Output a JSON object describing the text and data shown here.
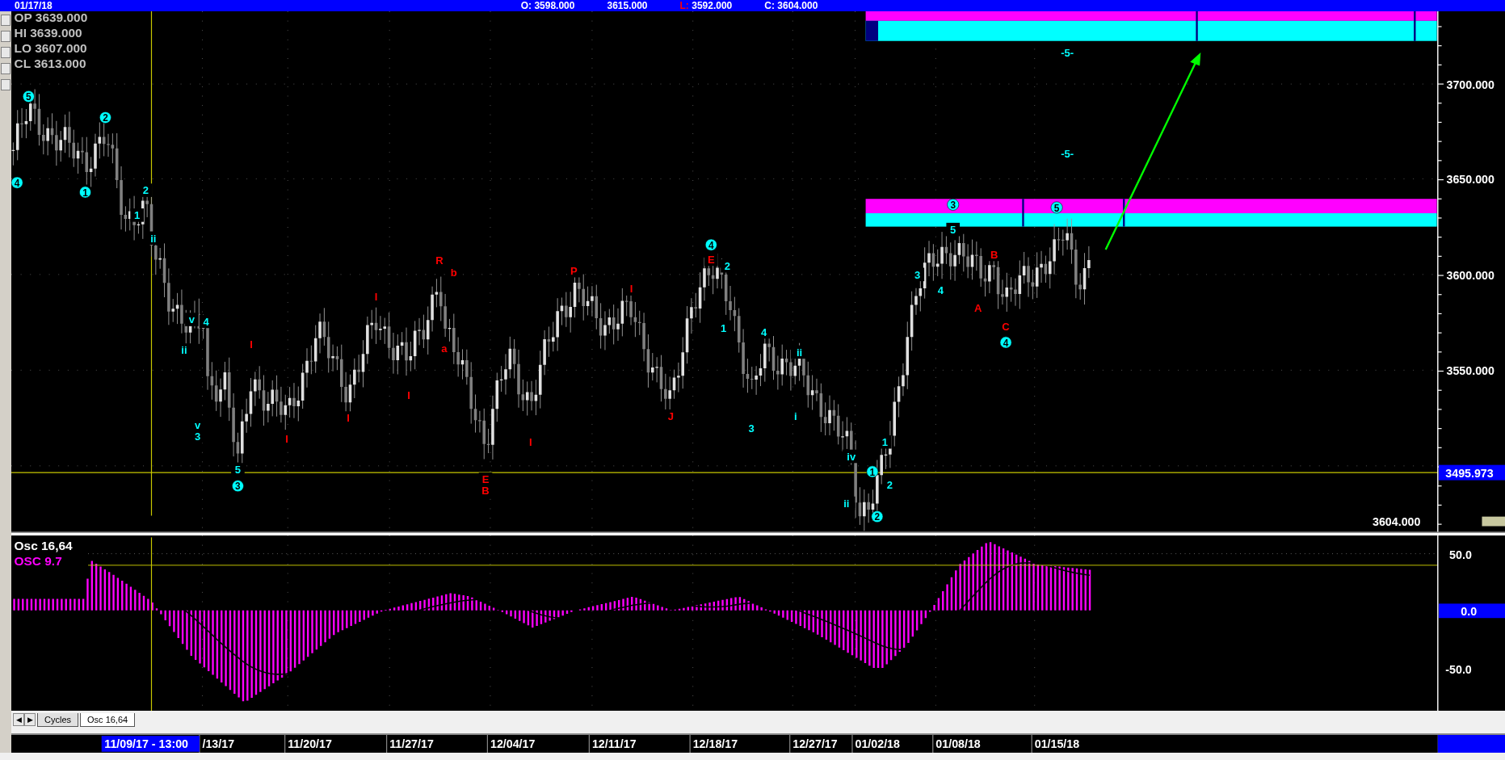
{
  "title_bar": {
    "date": "01/17/18",
    "readouts": [
      {
        "label": "O:",
        "color": "#ffffff",
        "value": "3598.000"
      },
      {
        "value": "3615.000"
      },
      {
        "label": "L:",
        "color": "#ff0000",
        "value": "3592.000"
      },
      {
        "label": "C:",
        "color": "#ffffff",
        "value": "3604.000"
      }
    ]
  },
  "price_panel": {
    "ohlc": [
      {
        "label": "OP",
        "value": "3639.000"
      },
      {
        "label": "HI",
        "value": "3639.000"
      },
      {
        "label": "LO",
        "value": "3607.000"
      },
      {
        "label": "CL",
        "value": "3613.000"
      }
    ],
    "axis_labels": [
      "3700.000",
      "3650.000",
      "3600.000",
      "3550.000"
    ],
    "cursor_price": "3495.973",
    "last_price": "3604.000",
    "wave_labels": [
      {
        "text": "5",
        "color": "#00ffff",
        "kind": "circled"
      },
      {
        "text": "4",
        "color": "#00ffff",
        "kind": "circled"
      },
      {
        "text": "1",
        "color": "#00ffff",
        "kind": "circled"
      },
      {
        "text": "2",
        "color": "#00ffff",
        "kind": "circled"
      },
      {
        "text": "2",
        "color": "#00ffff",
        "kind": "plain"
      },
      {
        "text": "1",
        "color": "#00ffff",
        "kind": "plain"
      },
      {
        "text": "ii",
        "color": "#00ffff",
        "kind": "plain"
      },
      {
        "text": "v",
        "color": "#00ffff",
        "kind": "plain"
      },
      {
        "text": "4",
        "color": "#00ffff",
        "kind": "plain"
      },
      {
        "text": "ii",
        "color": "#00ffff",
        "kind": "plain"
      },
      {
        "text": "v",
        "color": "#00ffff",
        "kind": "plain"
      },
      {
        "text": "3",
        "color": "#00ffff",
        "kind": "plain"
      },
      {
        "text": "5",
        "color": "#00ffff",
        "kind": "plain"
      },
      {
        "text": "3",
        "color": "#00ffff",
        "kind": "circled"
      },
      {
        "text": "I",
        "color": "#ff0000",
        "kind": "plain"
      },
      {
        "text": "I",
        "color": "#ff0000",
        "kind": "plain"
      },
      {
        "text": "I",
        "color": "#ff0000",
        "kind": "plain"
      },
      {
        "text": "I",
        "color": "#ff0000",
        "kind": "plain"
      },
      {
        "text": "I",
        "color": "#ff0000",
        "kind": "plain"
      },
      {
        "text": "R",
        "color": "#ff0000",
        "kind": "plain"
      },
      {
        "text": "b",
        "color": "#ff0000",
        "kind": "plain"
      },
      {
        "text": "a",
        "color": "#ff0000",
        "kind": "plain"
      },
      {
        "text": "E",
        "color": "#ff0000",
        "kind": "plain"
      },
      {
        "text": "B",
        "color": "#ff0000",
        "kind": "plain"
      },
      {
        "text": "I",
        "color": "#ff0000",
        "kind": "plain"
      },
      {
        "text": "P",
        "color": "#ff0000",
        "kind": "plain"
      },
      {
        "text": "I",
        "color": "#ff0000",
        "kind": "plain"
      },
      {
        "text": "J",
        "color": "#ff0000",
        "kind": "plain"
      },
      {
        "text": "4",
        "color": "#00ffff",
        "kind": "circled"
      },
      {
        "text": "E",
        "color": "#ff0000",
        "kind": "plain"
      },
      {
        "text": "2",
        "color": "#00ffff",
        "kind": "plain"
      },
      {
        "text": "1",
        "color": "#00ffff",
        "kind": "plain"
      },
      {
        "text": "4",
        "color": "#00ffff",
        "kind": "plain"
      },
      {
        "text": "ii",
        "color": "#00ffff",
        "kind": "plain"
      },
      {
        "text": "i",
        "color": "#00ffff",
        "kind": "plain"
      },
      {
        "text": "3",
        "color": "#00ffff",
        "kind": "plain"
      },
      {
        "text": "iv",
        "color": "#00ffff",
        "kind": "plain"
      },
      {
        "text": "ii",
        "color": "#00ffff",
        "kind": "plain"
      },
      {
        "text": "1",
        "color": "#00ffff",
        "kind": "circled"
      },
      {
        "text": "1",
        "color": "#00ffff",
        "kind": "plain"
      },
      {
        "text": "2",
        "color": "#00ffff",
        "kind": "plain"
      },
      {
        "text": "2",
        "color": "#00ffff",
        "kind": "circled"
      },
      {
        "text": "3",
        "color": "#00ffff",
        "kind": "plain"
      },
      {
        "text": "4",
        "color": "#00ffff",
        "kind": "plain"
      },
      {
        "text": "3",
        "color": "#00ffff",
        "kind": "circled"
      },
      {
        "text": "5",
        "color": "#00ffff",
        "kind": "plain"
      },
      {
        "text": "A",
        "color": "#ff0000",
        "kind": "plain"
      },
      {
        "text": "B",
        "color": "#ff0000",
        "kind": "plain"
      },
      {
        "text": "C",
        "color": "#ff0000",
        "kind": "plain"
      },
      {
        "text": "4",
        "color": "#00ffff",
        "kind": "circled"
      },
      {
        "text": "5",
        "color": "#00ffff",
        "kind": "circled"
      },
      {
        "text": "-5-",
        "color": "#00ffff",
        "kind": "plain"
      },
      {
        "text": "-5-",
        "color": "#00ffff",
        "kind": "plain"
      }
    ]
  },
  "oscillator_panel": {
    "name": "Osc 16,64",
    "reading": "OSC 9.7",
    "axis_labels": [
      "50.0",
      "0.0",
      "-50.0"
    ]
  },
  "tabs": {
    "nav": [
      "◀",
      "▶"
    ],
    "items": [
      {
        "label": "Cycles",
        "selected": false
      },
      {
        "label": "Osc 16,64",
        "selected": true
      }
    ]
  },
  "date_axis": {
    "cursor": "11/09/17 - 13:00",
    "labels": [
      "/13/17",
      "11/20/17",
      "11/27/17",
      "12/04/17",
      "12/11/17",
      "12/18/17",
      "12/27/17",
      "01/02/18",
      "01/08/18",
      "01/15/18"
    ]
  }
}
